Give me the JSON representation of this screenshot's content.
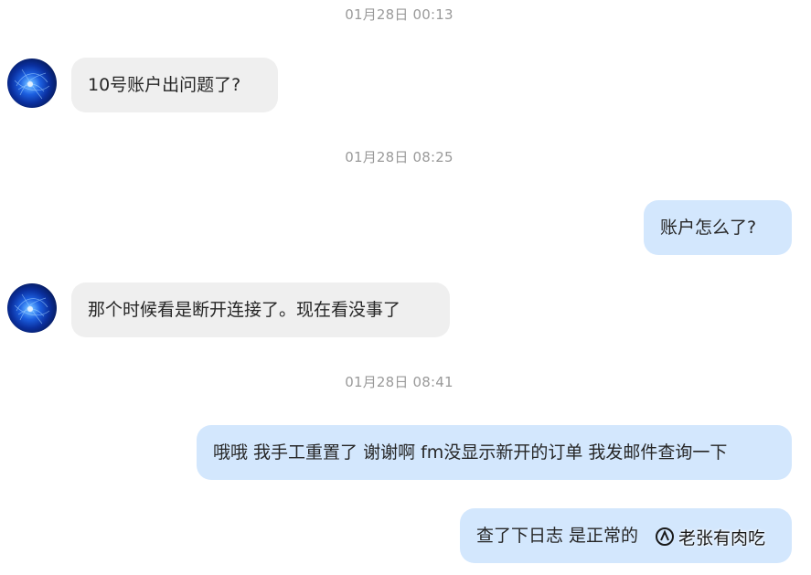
{
  "messages": [
    {
      "type": "timestamp",
      "text": "01月28日 00:13"
    },
    {
      "type": "incoming",
      "text": "10号账户出问题了?"
    },
    {
      "type": "timestamp",
      "text": "01月28日 08:25"
    },
    {
      "type": "outgoing",
      "text": "账户怎么了?"
    },
    {
      "type": "incoming",
      "text": "那个时候看是断开连接了。现在看没事了"
    },
    {
      "type": "timestamp",
      "text": "01月28日 08:41"
    },
    {
      "type": "outgoing",
      "text": "哦哦 我手工重置了 谢谢啊 fm没显示新开的订单 我发邮件查询一下"
    },
    {
      "type": "outgoing",
      "text": "查了下日志 是正常的"
    }
  ],
  "watermark": {
    "text": "老张有肉吃",
    "icon": "zhihu-logo-icon"
  },
  "colors": {
    "incoming_bubble": "#efefef",
    "outgoing_bubble": "#d3e7fd",
    "timestamp": "#9a9a9a"
  },
  "avatar_icon": "blue-orb-avatar-icon"
}
